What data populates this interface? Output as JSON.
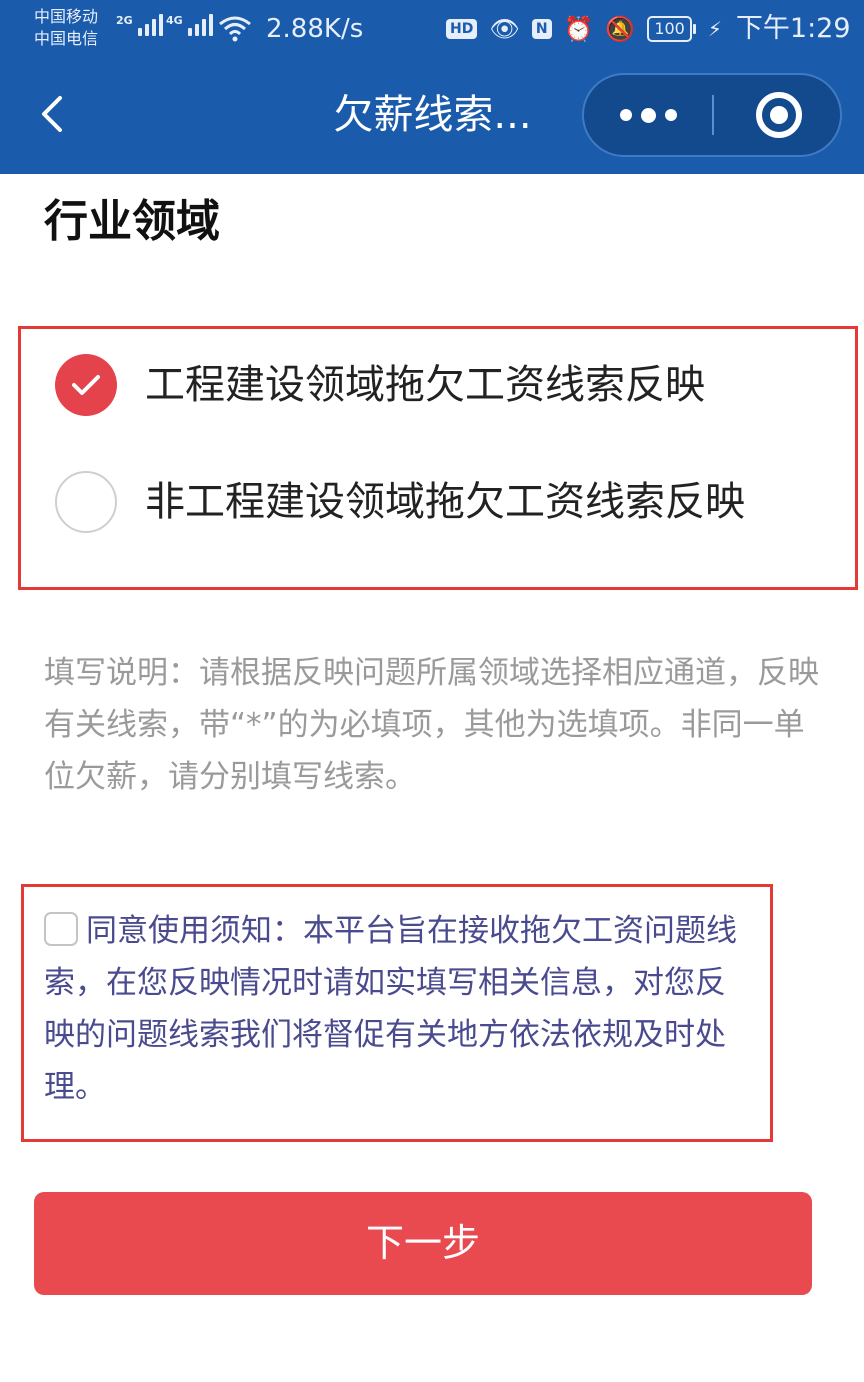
{
  "status_bar": {
    "carrier_1": "中国移动",
    "carrier_2": "中国电信",
    "signal_1_tag": "2G",
    "signal_2_tag": "4G",
    "net_speed": "2.88K/s",
    "hd_label": "HD",
    "nfc_label": "N",
    "battery": "100",
    "time": "下午1:29"
  },
  "nav": {
    "title": "欠薪线索...",
    "back_icon": "chevron-left-icon",
    "more_icon": "more-dots-icon",
    "close_icon": "target-close-icon"
  },
  "section": {
    "title": "行业领域"
  },
  "options": [
    {
      "label": "工程建设领域拖欠工资线索反映",
      "selected": true
    },
    {
      "label": "非工程建设领域拖欠工资线索反映",
      "selected": false
    }
  ],
  "instructions": "填写说明：请根据反映问题所属领域选择相应通道，反映有关线索，带“*”的为必填项，其他为选填项。非同一单位欠薪，请分别填写线索。",
  "agreement": {
    "checked": false,
    "text": "同意使用须知：本平台旨在接收拖欠工资问题线索，在您反映情况时请如实填写相关信息，对您反映的问题线索我们将督促有关地方依法依规及时处理。"
  },
  "next_button": "下一步",
  "colors": {
    "header_bg": "#1b5bab",
    "accent_red": "#e84a4f",
    "agreement_text": "#4a4b8f",
    "instruction_text": "#9a9a9a"
  }
}
